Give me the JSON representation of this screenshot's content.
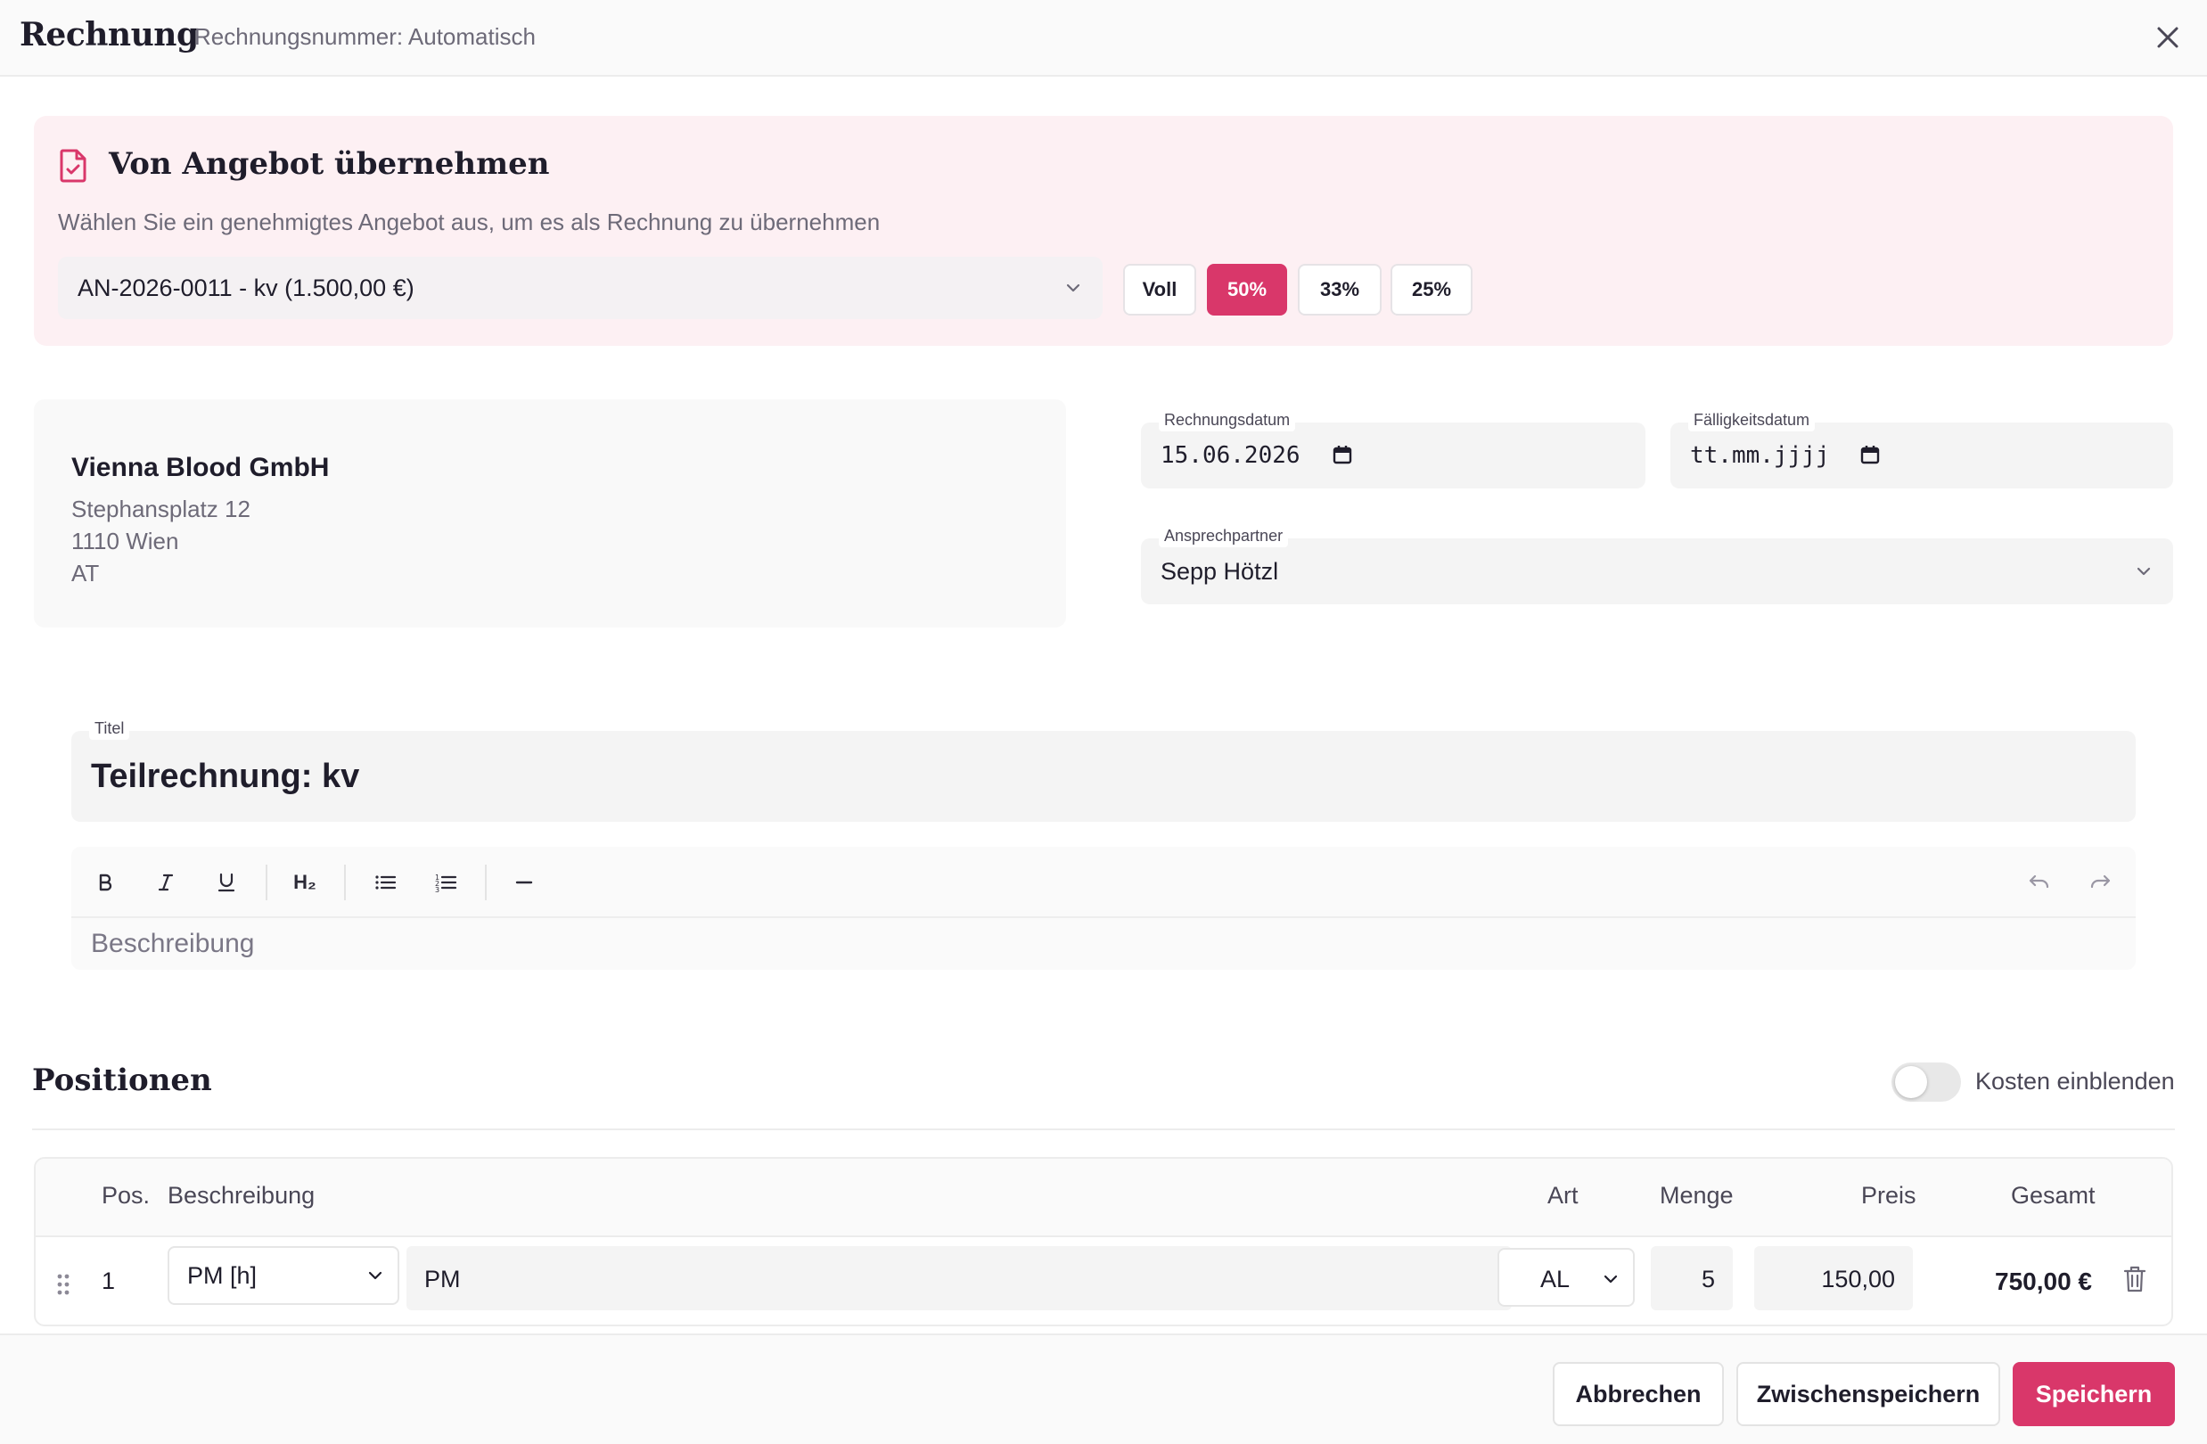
{
  "header": {
    "title": "Rechnung",
    "subtitle": "Rechnungsnummer: Automatisch",
    "close_icon": "close-icon"
  },
  "angebot": {
    "heading": "Von Angebot übernehmen",
    "hint": "Wählen Sie ein genehmigtes Angebot aus, um es als Rechnung zu übernehmen",
    "selected_offer": "AN-2026-0011 - kv (1.500,00 €)",
    "buttons": [
      "Voll",
      "50%",
      "33%",
      "25%"
    ],
    "active_button": "50%",
    "accent_color": "#d9376a",
    "panel_color": "#fdf0f3"
  },
  "customer": {
    "name": "Vienna Blood GmbH",
    "street": "Stephansplatz 12",
    "city": "1110 Wien",
    "country": "AT"
  },
  "dates": {
    "invoice_date_label": "Rechnungsdatum",
    "invoice_date_value": "15.06.2026",
    "due_date_label": "Fälligkeitsdatum",
    "due_date_placeholder": "tt.mm.jjjj"
  },
  "contact": {
    "label": "Ansprechpartner",
    "value": "Sepp Hötzl"
  },
  "title": {
    "label": "Titel",
    "value": "Teilrechnung: kv"
  },
  "editor": {
    "placeholder": "Beschreibung",
    "h2_label": "H₂"
  },
  "positions": {
    "heading": "Positionen",
    "toggle_label": "Kosten einblenden",
    "toggle_on": false,
    "columns": {
      "pos": "Pos.",
      "description": "Beschreibung",
      "type": "Art",
      "quantity": "Menge",
      "price": "Preis",
      "total": "Gesamt"
    },
    "rows": [
      {
        "pos": "1",
        "category": "PM [h]",
        "description": "PM",
        "type": "AL",
        "quantity": "5",
        "price": "150,00",
        "total": "750,00 €"
      }
    ]
  },
  "footer": {
    "cancel": "Abbrechen",
    "save_draft": "Zwischenspeichern",
    "save": "Speichern"
  }
}
